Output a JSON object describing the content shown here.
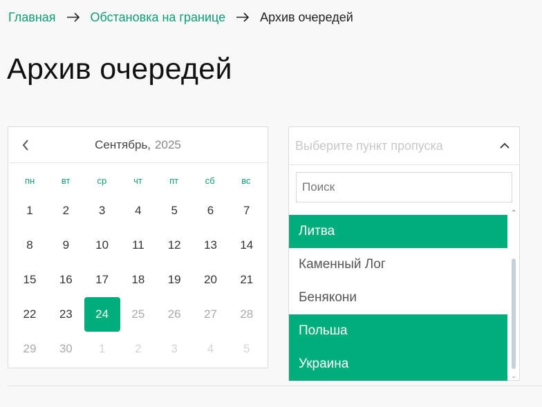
{
  "breadcrumb": {
    "home": "Главная",
    "section": "Обстановка на границе",
    "current": "Архив очередей"
  },
  "page": {
    "title": "Архив очередей"
  },
  "calendar": {
    "month": "Сентябрь,",
    "year": "2025",
    "weekdays": [
      "пн",
      "вт",
      "ср",
      "чт",
      "пт",
      "сб",
      "вс"
    ],
    "days": [
      {
        "n": "1",
        "state": "normal"
      },
      {
        "n": "2",
        "state": "normal"
      },
      {
        "n": "3",
        "state": "normal"
      },
      {
        "n": "4",
        "state": "normal"
      },
      {
        "n": "5",
        "state": "normal"
      },
      {
        "n": "6",
        "state": "normal"
      },
      {
        "n": "7",
        "state": "normal"
      },
      {
        "n": "8",
        "state": "normal"
      },
      {
        "n": "9",
        "state": "normal"
      },
      {
        "n": "10",
        "state": "normal"
      },
      {
        "n": "11",
        "state": "normal"
      },
      {
        "n": "12",
        "state": "normal"
      },
      {
        "n": "13",
        "state": "normal"
      },
      {
        "n": "14",
        "state": "normal"
      },
      {
        "n": "15",
        "state": "normal"
      },
      {
        "n": "16",
        "state": "normal"
      },
      {
        "n": "17",
        "state": "normal"
      },
      {
        "n": "18",
        "state": "normal"
      },
      {
        "n": "19",
        "state": "normal"
      },
      {
        "n": "20",
        "state": "normal"
      },
      {
        "n": "21",
        "state": "normal"
      },
      {
        "n": "22",
        "state": "normal"
      },
      {
        "n": "23",
        "state": "normal"
      },
      {
        "n": "24",
        "state": "selected"
      },
      {
        "n": "25",
        "state": "muted"
      },
      {
        "n": "26",
        "state": "muted"
      },
      {
        "n": "27",
        "state": "muted"
      },
      {
        "n": "28",
        "state": "muted"
      },
      {
        "n": "29",
        "state": "muted"
      },
      {
        "n": "30",
        "state": "muted"
      },
      {
        "n": "1",
        "state": "faded"
      },
      {
        "n": "2",
        "state": "faded"
      },
      {
        "n": "3",
        "state": "faded"
      },
      {
        "n": "4",
        "state": "faded"
      },
      {
        "n": "5",
        "state": "faded"
      }
    ],
    "icons": {
      "prev": "chevron-left-icon"
    }
  },
  "checkpoint": {
    "placeholder": "Выберите пункт пропуска",
    "search_placeholder": "Поиск",
    "items": [
      {
        "label": "Литва",
        "active": true
      },
      {
        "label": "Каменный Лог",
        "active": false
      },
      {
        "label": "Бенякони",
        "active": false
      },
      {
        "label": "Польша",
        "active": true
      },
      {
        "label": "Украина",
        "active": true
      }
    ],
    "icons": {
      "toggle": "chevron-up-icon"
    }
  },
  "colors": {
    "accent": "#00ae7b",
    "link": "#0e9c73"
  }
}
